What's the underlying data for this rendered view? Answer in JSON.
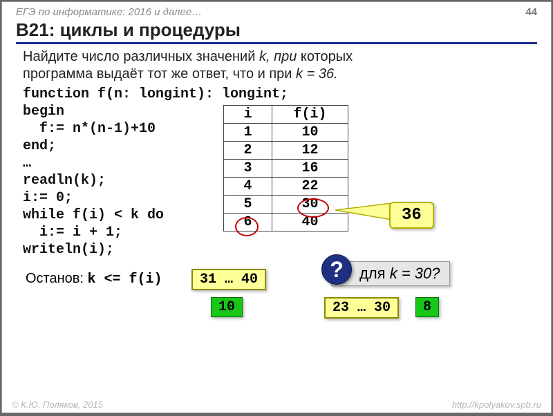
{
  "header": {
    "left": "ЕГЭ по информатике: 2016 и далее…",
    "page": "44"
  },
  "title": "B21: циклы и процедуры",
  "task_line1": "Найдите число различных значений ",
  "task_k": "k, при ",
  "task_line1b": "которых",
  "task_line2": "программа выдаёт тот же ответ, что и при ",
  "task_k2": "k = 36.",
  "code": "function f(n: longint): longint;\nbegin\n  f:= n*(n-1)+10\nend;\n…\nreadln(k);\ni:= 0;\nwhile f(i) < k do\n  i:= i + 1;\nwriteln(i);",
  "table": {
    "head": [
      "i",
      "f(i)"
    ],
    "rows": [
      [
        "1",
        "10"
      ],
      [
        "2",
        "12"
      ],
      [
        "3",
        "16"
      ],
      [
        "4",
        "22"
      ],
      [
        "5",
        "30"
      ],
      [
        "6",
        "40"
      ]
    ]
  },
  "call36": "36",
  "stop_label": "Останов: ",
  "stop_cond": "k <= f(i)",
  "box_range1": "31 … 40",
  "green10": "10",
  "box_range2": "23 … 30",
  "green8": "8",
  "qmark": "?",
  "forq_pre": "для ",
  "forq_k": "k = 30?",
  "footer": {
    "left": "© К.Ю. Поляков, 2015",
    "right": "http://kpolyakov.spb.ru"
  }
}
